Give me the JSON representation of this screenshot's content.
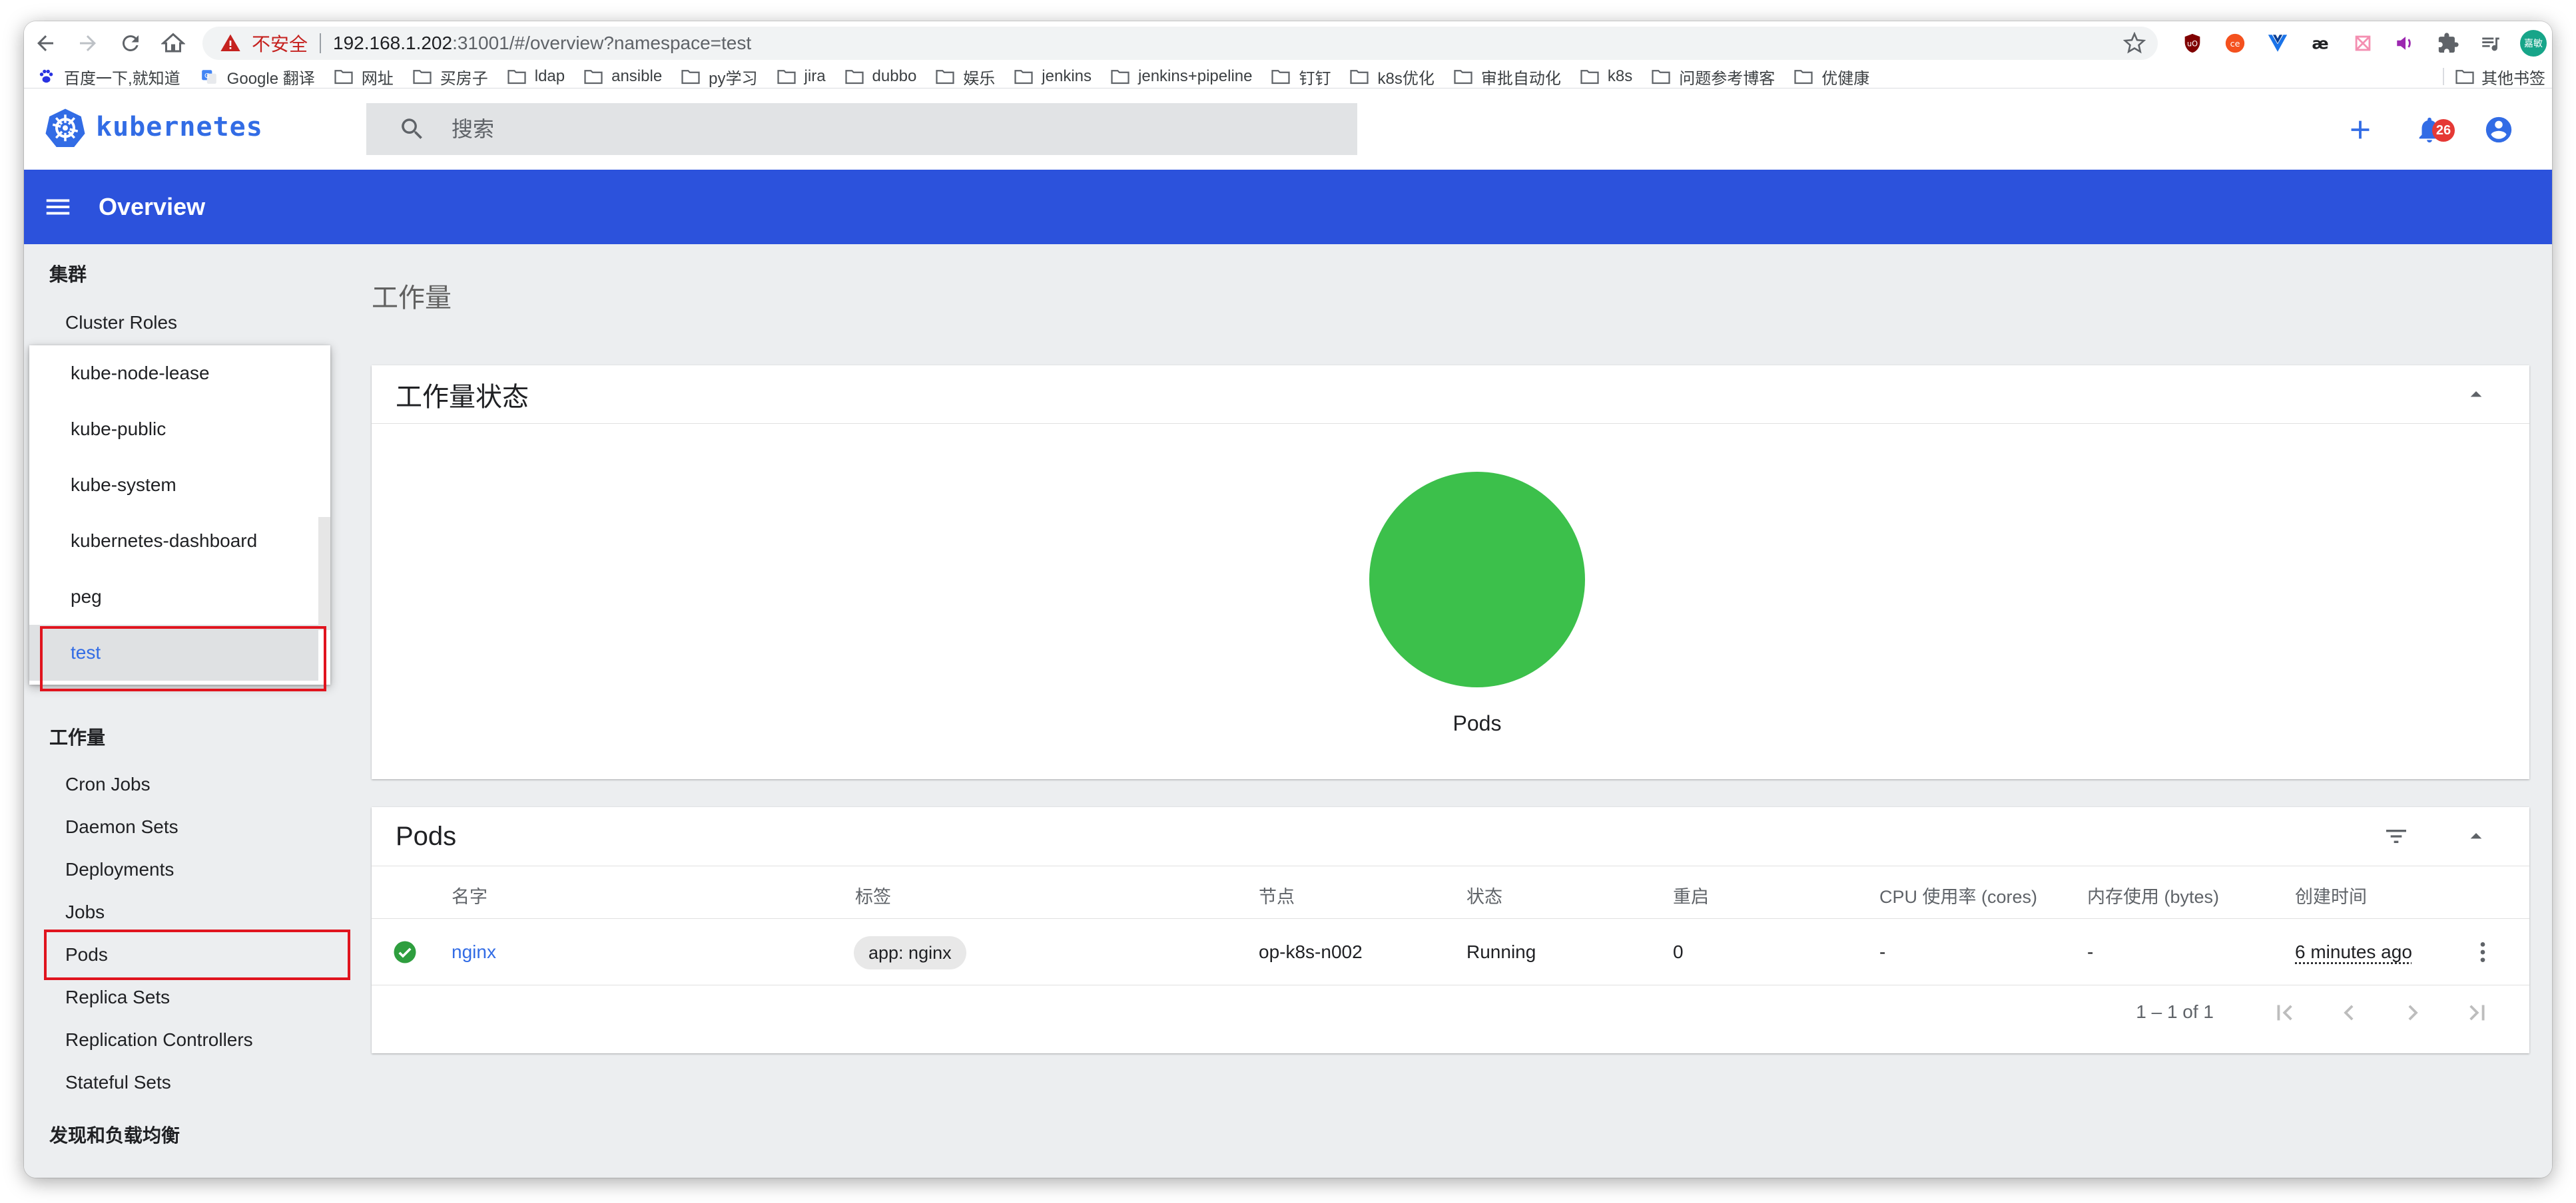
{
  "browser": {
    "insecure_label": "不安全",
    "url_host": "192.168.1.202",
    "url_path": ":31001/#/overview?namespace=test",
    "avatar_text": "嘉敏",
    "bookmarks": [
      "百度一下,就知道",
      "Google 翻译",
      "网址",
      "买房子",
      "ldap",
      "ansible",
      "py学习",
      "jira",
      "dubbo",
      "娱乐",
      "jenkins",
      "jenkins+pipeline",
      "钉钉",
      "k8s优化",
      "审批自动化",
      "k8s",
      "问题参考博客",
      "优健康"
    ],
    "other_bookmarks": "其他书签"
  },
  "header": {
    "logo_text": "kubernetes",
    "search_placeholder": "搜索",
    "notification_count": "26"
  },
  "appbar": {
    "title": "Overview"
  },
  "sidebar": {
    "cluster_title": "集群",
    "cluster_roles": "Cluster Roles",
    "namespaces": [
      "kube-node-lease",
      "kube-public",
      "kube-system",
      "kubernetes-dashboard",
      "peg",
      "test"
    ],
    "selected_namespace": "test",
    "workloads_title": "工作量",
    "workload_items": [
      "Cron Jobs",
      "Daemon Sets",
      "Deployments",
      "Jobs",
      "Pods",
      "Replica Sets",
      "Replication Controllers",
      "Stateful Sets"
    ],
    "discovery_title": "发现和负载均衡"
  },
  "main": {
    "heading": "工作量",
    "status_card_title": "工作量状态",
    "pie_label": "Pods",
    "pods_card_title": "Pods",
    "columns": [
      "名字",
      "标签",
      "节点",
      "状态",
      "重启",
      "CPU 使用率 (cores)",
      "内存使用 (bytes)",
      "创建时间"
    ],
    "rows": [
      {
        "name": "nginx",
        "label": "app: nginx",
        "node": "op-k8s-n002",
        "status": "Running",
        "restarts": "0",
        "cpu": "-",
        "memory": "-",
        "created": "6 minutes ago"
      }
    ],
    "pagination": "1 – 1 of 1"
  },
  "colors": {
    "accent": "#326ce5",
    "appbar": "#2c52dc",
    "running": "#3cc04b",
    "highlight": "#e0141e"
  }
}
